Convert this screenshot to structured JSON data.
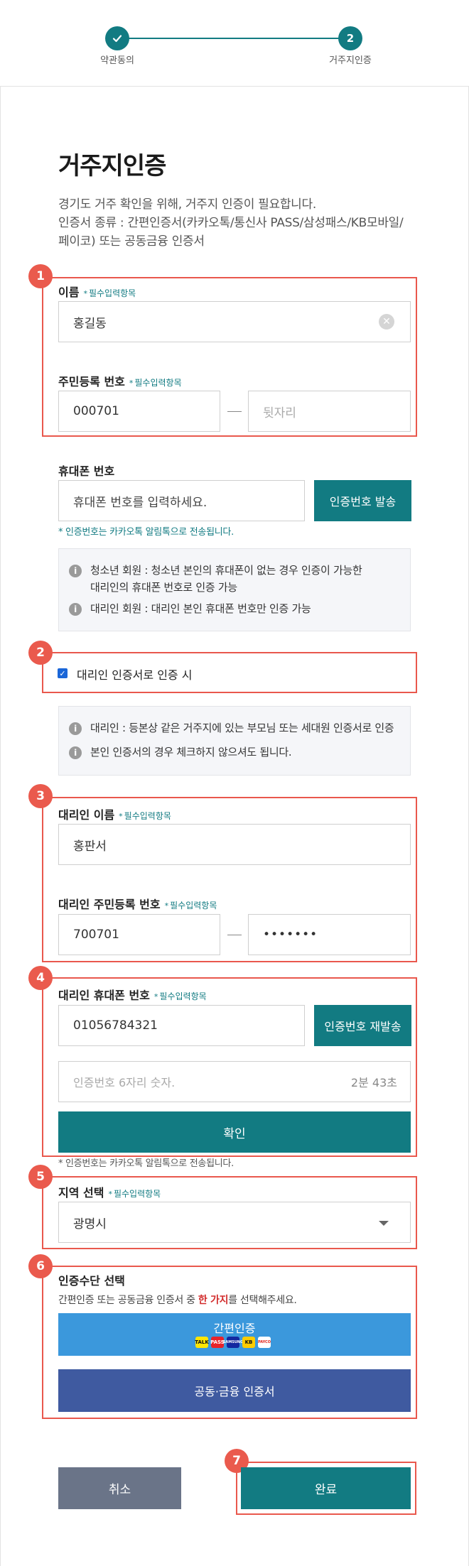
{
  "stepper": {
    "step1_label": "약관동의",
    "step2_number": "2",
    "step2_label": "거주지인증"
  },
  "page": {
    "title": "거주지인증",
    "desc_line1": "경기도 거주 확인을 위해, 거주지 인증이 필요합니다.",
    "desc_line2": "인증서 종류 : 간편인증서(카카오톡/통신사 PASS/삼성패스/KB모바일/",
    "desc_line3": "페이코) 또는 공동금융 인증서"
  },
  "required_label": "필수입력항목",
  "badges": [
    "1",
    "2",
    "3",
    "4",
    "5",
    "6",
    "7"
  ],
  "name": {
    "label": "이름",
    "value": "홍길동"
  },
  "rrn": {
    "label": "주민등록 번호",
    "front_value": "000701",
    "back_placeholder": "뒷자리"
  },
  "phone": {
    "label": "휴대폰 번호",
    "placeholder": "휴대폰 번호를 입력하세요.",
    "send_button": "인증번호 발송",
    "hint": "* 인증번호는 카카오톡 알림톡으로 전송됩니다."
  },
  "info1": {
    "line1a": "청소년 회원 : 청소년 본인의 휴대폰이 없는 경우 인증이 가능한",
    "line1b": "대리인의 휴대폰 번호로 인증 가능",
    "line2": "대리인 회원 : 대리인 본인 휴대폰 번호만 인증 가능"
  },
  "proxy_checkbox": {
    "label": "대리인 인증서로 인증 시",
    "checked": true
  },
  "info2": {
    "line1": "대리인 : 등본상 같은 거주지에 있는 부모님 또는 세대원 인증서로 인증",
    "line2": "본인 인증서의 경우 체크하지 않으셔도 됩니다."
  },
  "proxy_name": {
    "label": "대리인 이름",
    "value": "홍판서"
  },
  "proxy_rrn": {
    "label": "대리인 주민등록 번호",
    "front_value": "700701",
    "back_value": "•••••••"
  },
  "proxy_phone": {
    "label": "대리인 휴대폰 번호",
    "value": "01056784321",
    "resend_button": "인증번호 재발송",
    "code_placeholder": "인증번호 6자리 숫자.",
    "timer": "2분 43초",
    "confirm_button": "확인",
    "hint": "* 인증번호는 카카오톡 알림톡으로 전송됩니다."
  },
  "region": {
    "label": "지역 선택",
    "value": "광명시"
  },
  "auth_method": {
    "label": "인증수단 선택",
    "desc_before": "간편인증 또는 공동금융 인증서 중 ",
    "desc_strong": "한 가지",
    "desc_after": "를 선택해주세요.",
    "easy_button": "간편인증",
    "easy_icons": [
      "TALK",
      "PASS",
      "SAMSUNG",
      "KB",
      "PAYCO"
    ],
    "public_button": "공동·금융 인증서"
  },
  "footer": {
    "cancel_button": "취소",
    "done_button": "완료"
  },
  "colors": {
    "teal": "#127b82",
    "annotation_red": "#e9584d",
    "easy_blue": "#3b98dc",
    "public_navy": "#3f5aa0",
    "cancel_gray": "#6a7488"
  }
}
